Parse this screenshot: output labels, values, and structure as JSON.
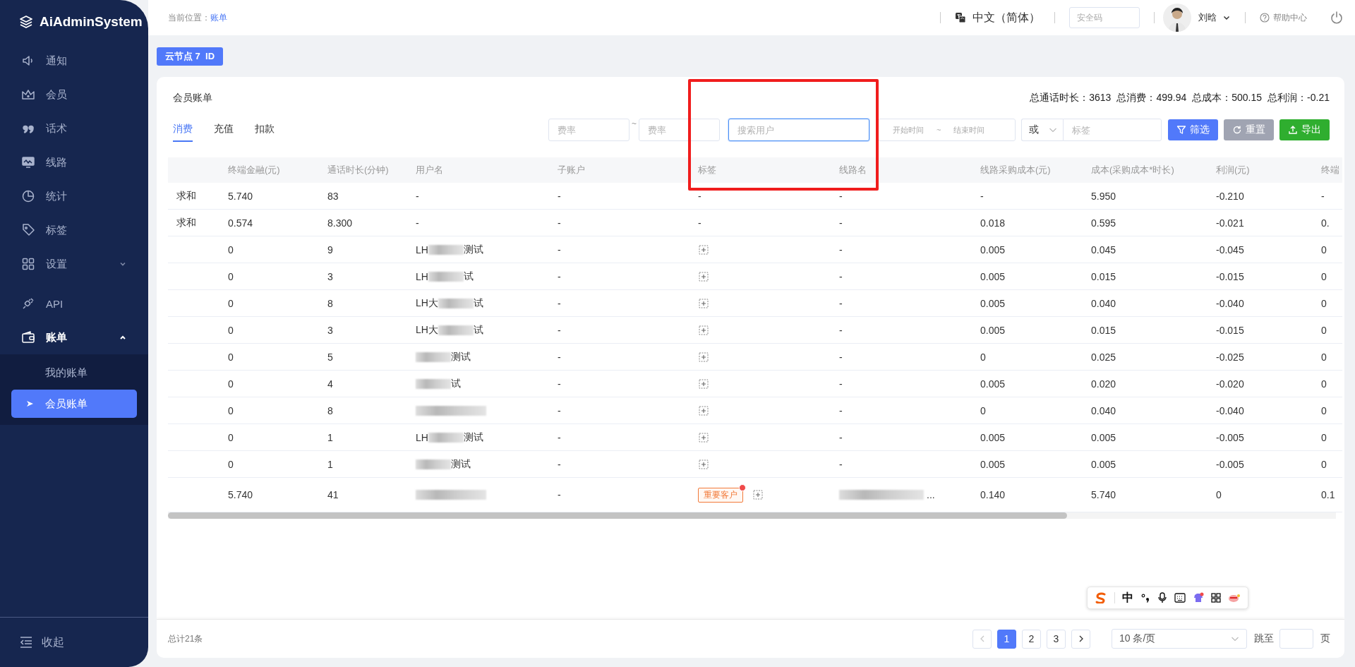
{
  "sidebar": {
    "logo": "AiAdminSystem",
    "items": [
      {
        "label": "通知",
        "selected": false
      },
      {
        "label": "会员",
        "selected": false
      },
      {
        "label": "话术",
        "selected": false
      },
      {
        "label": "线路",
        "selected": false
      },
      {
        "label": "统计",
        "selected": false
      },
      {
        "label": "标签",
        "selected": false
      },
      {
        "label": "设置",
        "selected": false,
        "expanded": false
      },
      {
        "label": "API",
        "selected": false
      },
      {
        "label": "账单",
        "selected": true,
        "expanded": true,
        "children": [
          {
            "label": "我的账单",
            "selected": false
          },
          {
            "label": "会员账单",
            "selected": true
          }
        ]
      }
    ],
    "collapse": "收起"
  },
  "topbar": {
    "breadcrumb_label": "当前位置：",
    "breadcrumb_current": "账单",
    "language": "中文（简体）",
    "security_code": {
      "placeholder": "安全码"
    },
    "user": "刘晗",
    "help": "帮助中心"
  },
  "node_tag": "云节点 7  ID",
  "card": {
    "title": "会员账单",
    "totals": [
      "总通话时长：3613",
      "总消费：499.94",
      "总成本：500.15",
      "总利润：-0.21"
    ],
    "tabs": [
      {
        "label": "消费",
        "selected": true
      },
      {
        "label": "充值",
        "selected": false
      },
      {
        "label": "扣款",
        "selected": false
      }
    ],
    "filters": {
      "rate_min": {
        "placeholder": "费率"
      },
      "rate_separator": "~",
      "rate_max": {
        "placeholder": "费率"
      },
      "search": {
        "placeholder": "搜索用户",
        "focused": true
      },
      "date_range": {
        "start_placeholder": "开始时间",
        "separator": "~",
        "end_placeholder": "结束时间"
      },
      "logic_select": {
        "value": "或"
      },
      "tag_field": {
        "placeholder": "标签"
      },
      "buttons": [
        {
          "label": "筛选",
          "kind": "filter"
        },
        {
          "label": "重置",
          "kind": "reset"
        },
        {
          "label": "导出",
          "kind": "export"
        }
      ]
    },
    "table": {
      "columns": [
        "终端金融(元)",
        "通话时长(分钟)",
        "用户名",
        "子账户",
        "标签",
        "线路名",
        "线路采购成本(元)",
        "成本(采购成本*时长)",
        "利润(元)",
        "终端"
      ],
      "rows": [
        {
          "row_label": "求和",
          "amount": "5.740",
          "duration": "83",
          "user": {
            "text": "-"
          },
          "sub_account": "-",
          "tags": {
            "text": "-"
          },
          "line": {
            "text": "-"
          },
          "line_cost": "-",
          "cost": "5.950",
          "profit": "-0.210",
          "terminal": "-"
        },
        {
          "row_label": "求和",
          "amount": "0.574",
          "duration": "8.300",
          "user": {
            "text": "-"
          },
          "sub_account": "-",
          "tags": {
            "text": "-"
          },
          "line": {
            "text": "-"
          },
          "line_cost": "0.018",
          "cost": "0.595",
          "profit": "-0.021",
          "terminal": "0."
        },
        {
          "amount": "0",
          "duration": "9",
          "user": {
            "prefix": "LH",
            "suffix": "测试",
            "redacted": true
          },
          "sub_account": "-",
          "tags": {
            "add": true
          },
          "line": {
            "text": "-"
          },
          "line_cost": "0.005",
          "cost": "0.045",
          "profit": "-0.045",
          "terminal": "0"
        },
        {
          "amount": "0",
          "duration": "3",
          "user": {
            "prefix": "LH",
            "suffix": "试",
            "redacted": true
          },
          "sub_account": "-",
          "tags": {
            "add": true
          },
          "line": {
            "text": "-"
          },
          "line_cost": "0.005",
          "cost": "0.015",
          "profit": "-0.015",
          "terminal": "0"
        },
        {
          "amount": "0",
          "duration": "8",
          "user": {
            "prefix": "LH大",
            "suffix": "试",
            "redacted": true
          },
          "sub_account": "-",
          "tags": {
            "add": true
          },
          "line": {
            "text": "-"
          },
          "line_cost": "0.005",
          "cost": "0.040",
          "profit": "-0.040",
          "terminal": "0"
        },
        {
          "amount": "0",
          "duration": "3",
          "user": {
            "prefix": "LH大",
            "suffix": "试",
            "redacted": true
          },
          "sub_account": "-",
          "tags": {
            "add": true
          },
          "line": {
            "text": "-"
          },
          "line_cost": "0.005",
          "cost": "0.015",
          "profit": "-0.015",
          "terminal": "0"
        },
        {
          "amount": "0",
          "duration": "5",
          "user": {
            "suffix": "测试",
            "redacted": true
          },
          "sub_account": "-",
          "tags": {
            "add": true
          },
          "line": {
            "text": "-"
          },
          "line_cost": "0",
          "cost": "0.025",
          "profit": "-0.025",
          "terminal": "0"
        },
        {
          "amount": "0",
          "duration": "4",
          "user": {
            "suffix": "试",
            "redacted": true
          },
          "sub_account": "-",
          "tags": {
            "add": true
          },
          "line": {
            "text": "-"
          },
          "line_cost": "0.005",
          "cost": "0.020",
          "profit": "-0.020",
          "terminal": "0"
        },
        {
          "amount": "0",
          "duration": "8",
          "user": {
            "redacted": true
          },
          "sub_account": "-",
          "tags": {
            "add": true
          },
          "line": {
            "text": "-"
          },
          "line_cost": "0",
          "cost": "0.040",
          "profit": "-0.040",
          "terminal": "0"
        },
        {
          "amount": "0",
          "duration": "1",
          "user": {
            "prefix": "LH",
            "suffix": "测试",
            "redacted": true
          },
          "sub_account": "-",
          "tags": {
            "add": true
          },
          "line": {
            "text": "-"
          },
          "line_cost": "0.005",
          "cost": "0.005",
          "profit": "-0.005",
          "terminal": "0"
        },
        {
          "amount": "0",
          "duration": "1",
          "user": {
            "suffix": "测试",
            "redacted": true
          },
          "sub_account": "-",
          "tags": {
            "add": true
          },
          "line": {
            "text": "-"
          },
          "line_cost": "0.005",
          "cost": "0.005",
          "profit": "-0.005",
          "terminal": "0"
        },
        {
          "amount": "5.740",
          "duration": "41",
          "user": {
            "redacted": true
          },
          "sub_account": "-",
          "tags": {
            "add": true,
            "items": [
              {
                "label": "重要客户",
                "removable": true
              }
            ]
          },
          "line": {
            "redacted": true,
            "suffix": "..."
          },
          "line_cost": "0.140",
          "cost": "5.740",
          "profit": "0",
          "terminal": "0.1"
        }
      ]
    },
    "footer": {
      "total": "总计21条",
      "pager": {
        "prev_disabled": true,
        "next_disabled": false,
        "pages": [
          {
            "label": "1",
            "selected": true
          },
          {
            "label": "2",
            "selected": false
          },
          {
            "label": "3",
            "selected": false
          }
        ]
      },
      "page_size": "10 条/页",
      "jump_label": "跳至",
      "page_unit": "页"
    }
  },
  "ime_toolbar": {
    "label": "中"
  },
  "annotations": [
    {
      "kind": "rectangle"
    }
  ]
}
